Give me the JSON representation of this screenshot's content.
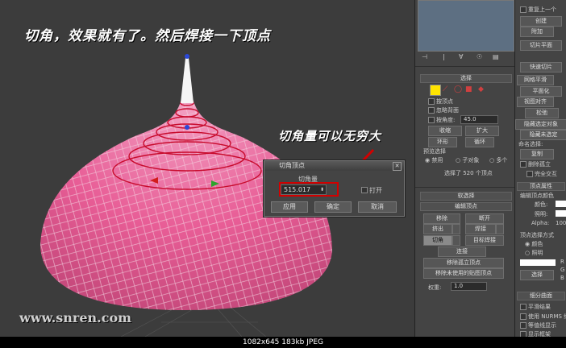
{
  "annotations": {
    "top": "切角，效果就有了。然后焊接一下顶点",
    "right": "切角量可以无穷大",
    "watermark": "www.snren.com"
  },
  "dialog": {
    "title": "切角顶点",
    "amount_label": "切角量",
    "amount_value": "515.017",
    "open_label": "打开",
    "apply_label": "应用",
    "ok_label": "确定",
    "cancel_label": "取消"
  },
  "command_panel": {
    "selection_head": "选择",
    "by_vertex": "按顶点",
    "ignore_backfacing": "忽略背面",
    "by_angle": "按角度:",
    "by_angle_value": "45.0",
    "shrink": "收缩",
    "grow": "扩大",
    "ring": "环形",
    "loop": "循环",
    "preview_label": "预览选择",
    "preview_off": "禁用",
    "preview_subobj": "子对象",
    "preview_multi": "多个",
    "selected_text": "选择了 520 个顶点",
    "soft_selection_head": "软选择",
    "edit_vertices_head": "编辑顶点",
    "remove": "移除",
    "break": "断开",
    "extrude": "挤出",
    "weld": "焊接",
    "chamfer": "切角",
    "target_weld": "目标焊接",
    "connect": "连接",
    "remove_isolated": "移除孤立顶点",
    "remove_unused_map": "移除未使用的贴图顶点",
    "weight_label": "权重:",
    "weight_value": "1.0"
  },
  "far_panel": {
    "repeat_last": "重复上一个",
    "create": "创建",
    "attach": "附加",
    "slice_plane": "切片平面",
    "quick_slice": "快速切片",
    "mesh_smooth": "网格平滑",
    "tessellate": "平面化",
    "view_align": "视图对齐",
    "relax": "松弛",
    "hide_selected": "隐藏选定对象",
    "hide_unselected": "隐藏未选定",
    "named_sel": "命名选择:",
    "copy": "复制",
    "delete_isolated": "删除孤立",
    "full_interactivity": "完全交互",
    "vertex_props_head": "顶点属性",
    "edit_vertex_colors": "编辑顶点颜色",
    "color_label": "颜色:",
    "illum_label": "照明:",
    "alpha_label": "Alpha:",
    "alpha_value": "100",
    "vertex_select_by": "顶点选择方式",
    "by_color": "颜色",
    "by_illum": "照明",
    "select": "选择",
    "r_label": "R",
    "g_label": "G",
    "b_label": "B",
    "subdiv_head": "细分曲面",
    "smooth_result": "平滑结果",
    "use_nurms": "使用 NURMS 细分",
    "isoline_display": "等值线显示",
    "show_cage": "显示框架"
  },
  "status_bar": {
    "image_info": "1082x645  183kb  JPEG"
  },
  "colors": {
    "mesh_fill": "#e85d96",
    "mesh_lines": "#f3d4e2",
    "red_edges": "#c80b2d",
    "viewport_bg": "#3c3c3c",
    "highlight_box": "#d20000",
    "vertex_swatch": "#ffe400"
  }
}
